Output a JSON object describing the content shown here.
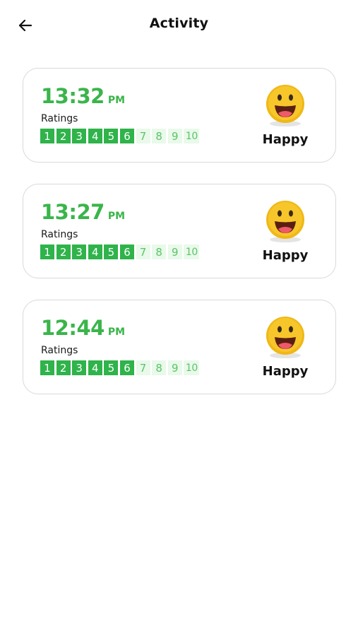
{
  "header": {
    "title": "Activity"
  },
  "colors": {
    "accent": "#3ab54a",
    "scale_on": "#2fb34a",
    "scale_off": "#e9f9ea"
  },
  "ratings_scale": [
    "1",
    "2",
    "3",
    "4",
    "5",
    "6",
    "7",
    "8",
    "9",
    "10"
  ],
  "entries": [
    {
      "time": "13:32",
      "ampm": "PM",
      "ratings_label": "Ratings",
      "rating": 6,
      "mood": "Happy",
      "mood_icon": "happy-face-emoji"
    },
    {
      "time": "13:27",
      "ampm": "PM",
      "ratings_label": "Ratings",
      "rating": 6,
      "mood": "Happy",
      "mood_icon": "happy-face-emoji"
    },
    {
      "time": "12:44",
      "ampm": "PM",
      "ratings_label": "Ratings",
      "rating": 6,
      "mood": "Happy",
      "mood_icon": "happy-face-emoji"
    }
  ]
}
